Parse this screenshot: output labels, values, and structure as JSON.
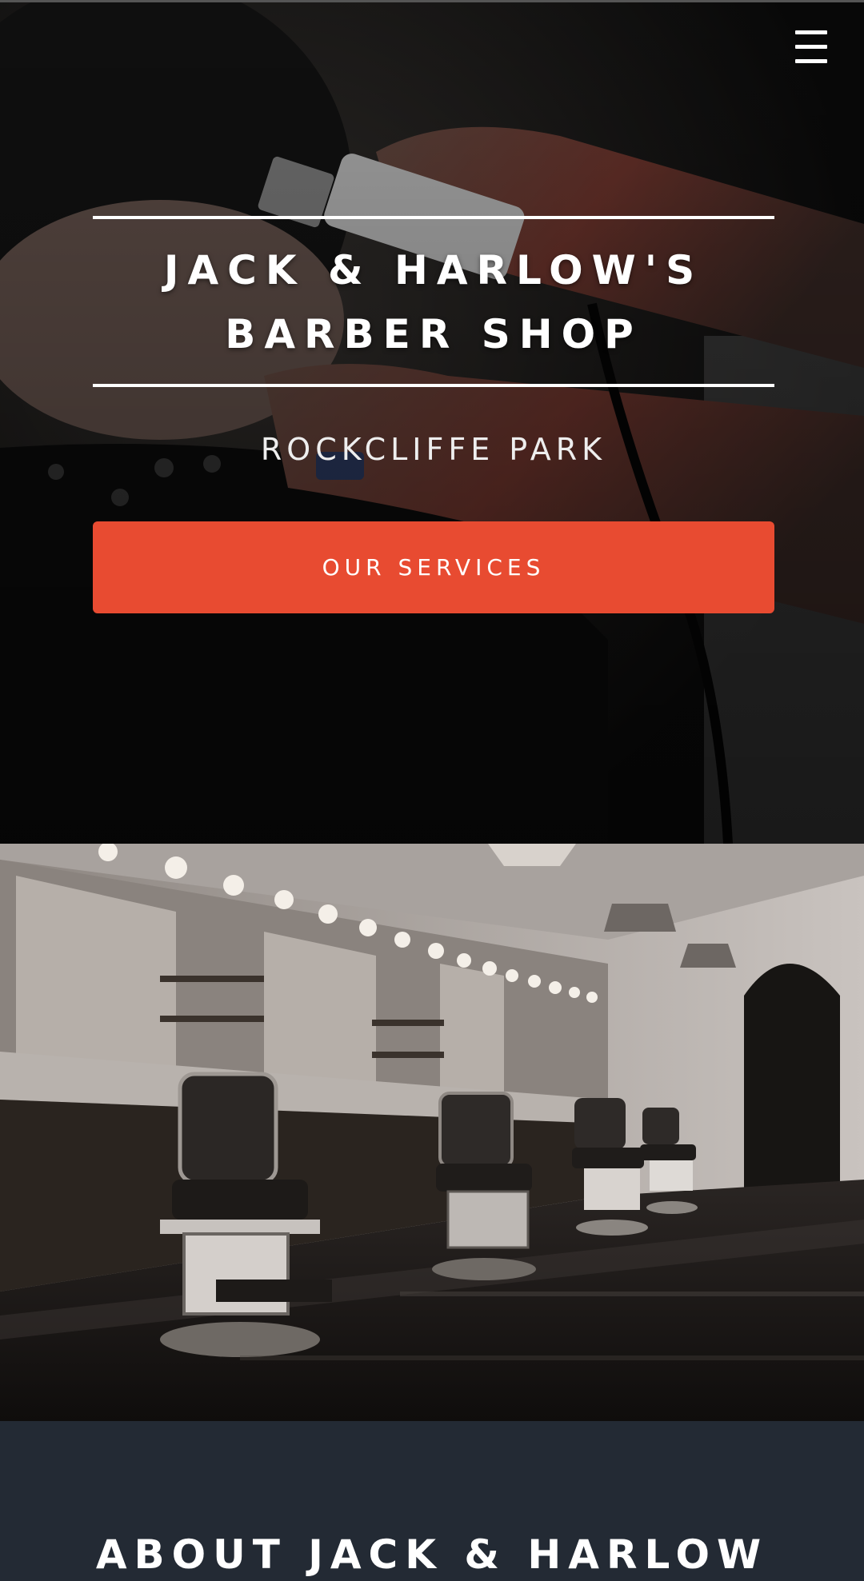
{
  "nav": {
    "menu_icon": "hamburger-menu-icon"
  },
  "hero": {
    "title_line1": "JACK & HARLOW'S",
    "title_line2": "BARBER SHOP",
    "location": "ROCKCLIFFE PARK",
    "cta_label": "OUR SERVICES",
    "accent_color": "#e84b31",
    "image_subject": "barber trimming a client's neckline with clippers"
  },
  "gallery": {
    "image_subject": "barber shop interior with barber chairs, mirrors and vanity lights"
  },
  "about": {
    "heading": "ABOUT JACK & HARLOW",
    "background_color": "#232a34"
  }
}
